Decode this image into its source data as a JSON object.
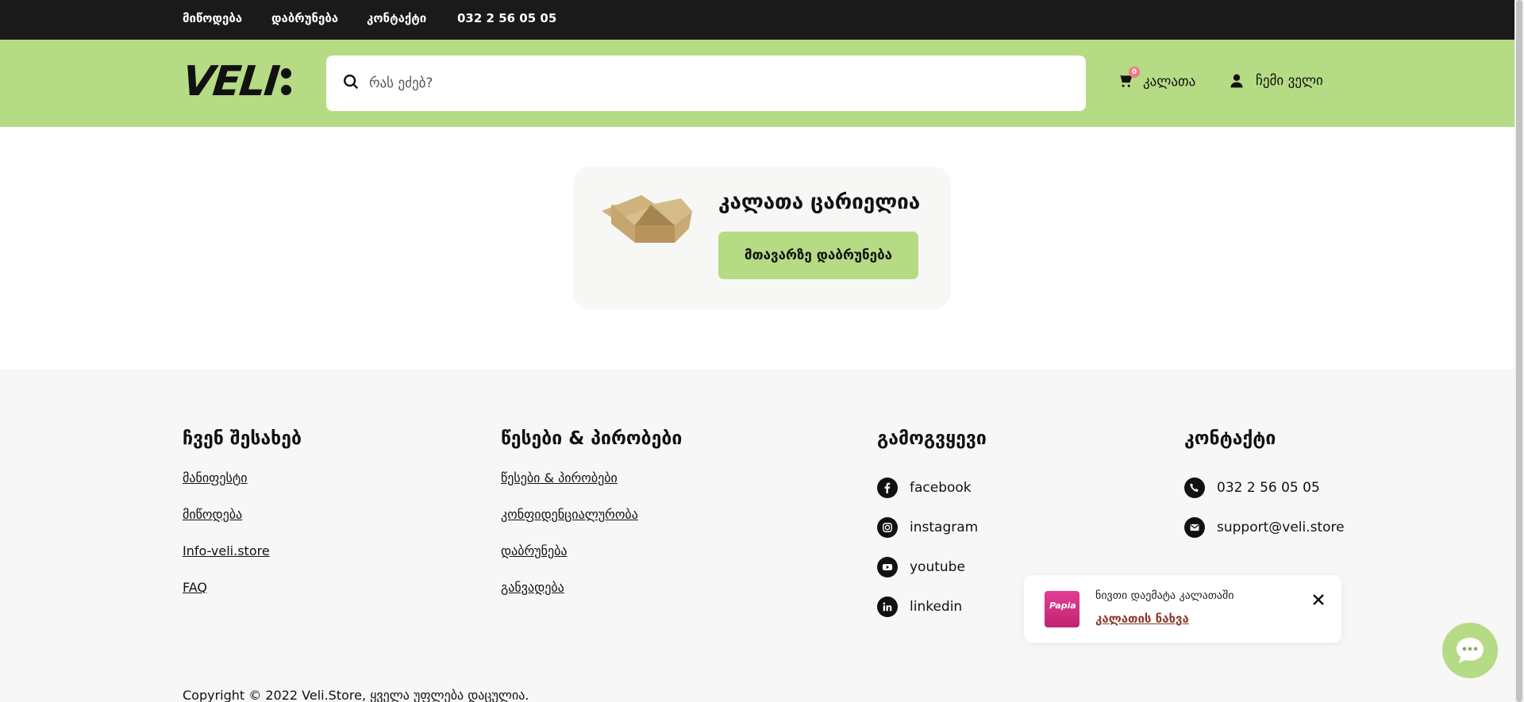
{
  "topbar": {
    "links": [
      "მიწოდება",
      "დაბრუნება",
      "კონტაქტი",
      "032 2 56 05 05"
    ]
  },
  "header": {
    "logo_text": "VELI",
    "search_placeholder": "რას ეძებ?",
    "cart_label": "კალათა",
    "cart_count": "0",
    "account_label": "ჩემი ველი"
  },
  "empty_cart": {
    "title": "კალათა ცარიელია",
    "button_label": "მთავარზე დაბრუნება"
  },
  "footer": {
    "about": {
      "heading": "ჩვენ შესახებ",
      "links": [
        "მანიფესტი",
        "მიწოდება",
        "Info-veli.store",
        "FAQ"
      ]
    },
    "terms": {
      "heading": "წესები & პირობები",
      "links": [
        "წესები & პირობები",
        "კონფიდენციალურობა",
        "დაბრუნება",
        "განვადება"
      ]
    },
    "follow": {
      "heading": "გამოგვყევი",
      "links": [
        {
          "label": "facebook",
          "icon": "facebook-icon"
        },
        {
          "label": "instagram",
          "icon": "instagram-icon"
        },
        {
          "label": "youtube",
          "icon": "youtube-icon"
        },
        {
          "label": "linkedin",
          "icon": "linkedin-icon"
        }
      ]
    },
    "contact": {
      "heading": "კონტაქტი",
      "phone": "032 2 56 05 05",
      "email": "support@veli.store"
    },
    "copyright": "Copyright © 2022 Veli.Store, ყველა უფლება დაცულია."
  },
  "toast": {
    "message": "ნივთი დაემატა კალათაში",
    "link": "კალათის ნახვა",
    "product_brand": "Papia"
  },
  "colors": {
    "brand_green": "#b5db85",
    "topbar": "#1a1a1a",
    "badge": "#f0788a",
    "toast_link": "#8b3a2e"
  }
}
